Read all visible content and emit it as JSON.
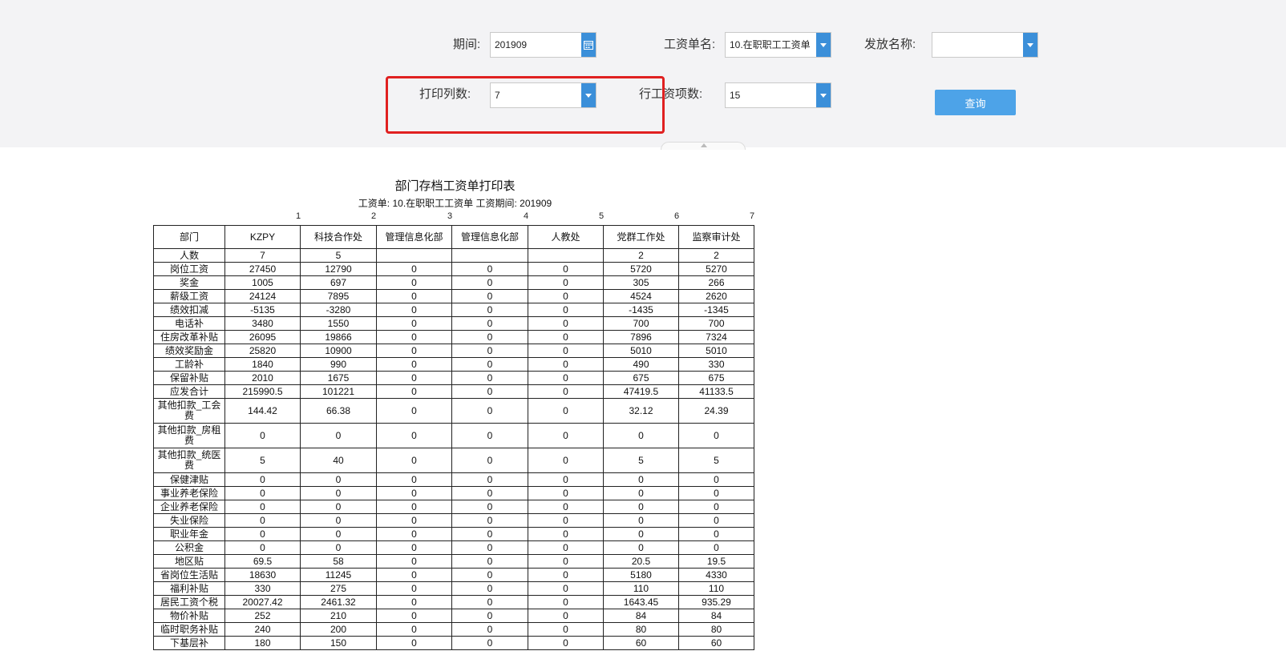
{
  "filters": {
    "period_label": "期间:",
    "period_value": "201909",
    "payroll_name_label": "工资单名:",
    "payroll_name_value": "10.在职职工工资单",
    "issue_name_label": "发放名称:",
    "issue_name_value": "",
    "print_cols_label": "打印列数:",
    "print_cols_value": "7",
    "row_items_label": "行工资项数:",
    "row_items_value": "15",
    "query_label": "查询"
  },
  "report": {
    "title": "部门存档工资单打印表",
    "subtitle": "工资单: 10.在职职工工资单 工资期间: 201909",
    "col_numbers": [
      "1",
      "2",
      "3",
      "4",
      "5",
      "6",
      "7"
    ],
    "header": [
      "部门",
      "KZPY",
      "科技合作处",
      "管理信息化部",
      "管理信息化部",
      "人教处",
      "党群工作处",
      "监察审计处"
    ],
    "rows": [
      [
        "人数",
        "7",
        "5",
        "",
        "",
        "",
        "2",
        "2"
      ],
      [
        "岗位工资",
        "27450",
        "12790",
        "0",
        "0",
        "0",
        "5720",
        "5270"
      ],
      [
        "奖金",
        "1005",
        "697",
        "0",
        "0",
        "0",
        "305",
        "266"
      ],
      [
        "薪级工资",
        "24124",
        "7895",
        "0",
        "0",
        "0",
        "4524",
        "2620"
      ],
      [
        "绩效扣减",
        "-5135",
        "-3280",
        "0",
        "0",
        "0",
        "-1435",
        "-1345"
      ],
      [
        "电话补",
        "3480",
        "1550",
        "0",
        "0",
        "0",
        "700",
        "700"
      ],
      [
        "住房改革补贴",
        "26095",
        "19866",
        "0",
        "0",
        "0",
        "7896",
        "7324"
      ],
      [
        "绩效奖励金",
        "25820",
        "10900",
        "0",
        "0",
        "0",
        "5010",
        "5010"
      ],
      [
        "工龄补",
        "1840",
        "990",
        "0",
        "0",
        "0",
        "490",
        "330"
      ],
      [
        "保留补贴",
        "2010",
        "1675",
        "0",
        "0",
        "0",
        "675",
        "675"
      ],
      [
        "应发合计",
        "215990.5",
        "101221",
        "0",
        "0",
        "0",
        "47419.5",
        "41133.5"
      ],
      [
        "其他扣款_工会费",
        "144.42",
        "66.38",
        "0",
        "0",
        "0",
        "32.12",
        "24.39"
      ],
      [
        "其他扣款_房租费",
        "0",
        "0",
        "0",
        "0",
        "0",
        "0",
        "0"
      ],
      [
        "其他扣款_统医费",
        "5",
        "40",
        "0",
        "0",
        "0",
        "5",
        "5"
      ],
      [
        "保健津贴",
        "0",
        "0",
        "0",
        "0",
        "0",
        "0",
        "0"
      ],
      [
        "事业养老保险",
        "0",
        "0",
        "0",
        "0",
        "0",
        "0",
        "0"
      ],
      [
        "企业养老保险",
        "0",
        "0",
        "0",
        "0",
        "0",
        "0",
        "0"
      ],
      [
        "失业保险",
        "0",
        "0",
        "0",
        "0",
        "0",
        "0",
        "0"
      ],
      [
        "职业年金",
        "0",
        "0",
        "0",
        "0",
        "0",
        "0",
        "0"
      ],
      [
        "公积金",
        "0",
        "0",
        "0",
        "0",
        "0",
        "0",
        "0"
      ],
      [
        "地区贴",
        "69.5",
        "58",
        "0",
        "0",
        "0",
        "20.5",
        "19.5"
      ],
      [
        "省岗位生活贴",
        "18630",
        "11245",
        "0",
        "0",
        "0",
        "5180",
        "4330"
      ],
      [
        "福利补贴",
        "330",
        "275",
        "0",
        "0",
        "0",
        "110",
        "110"
      ],
      [
        "居民工资个税",
        "20027.42",
        "2461.32",
        "0",
        "0",
        "0",
        "1643.45",
        "935.29"
      ],
      [
        "物价补贴",
        "252",
        "210",
        "0",
        "0",
        "0",
        "84",
        "84"
      ],
      [
        "临时职务补贴",
        "240",
        "200",
        "0",
        "0",
        "0",
        "80",
        "80"
      ],
      [
        "下基层补",
        "180",
        "150",
        "0",
        "0",
        "0",
        "60",
        "60"
      ]
    ]
  }
}
